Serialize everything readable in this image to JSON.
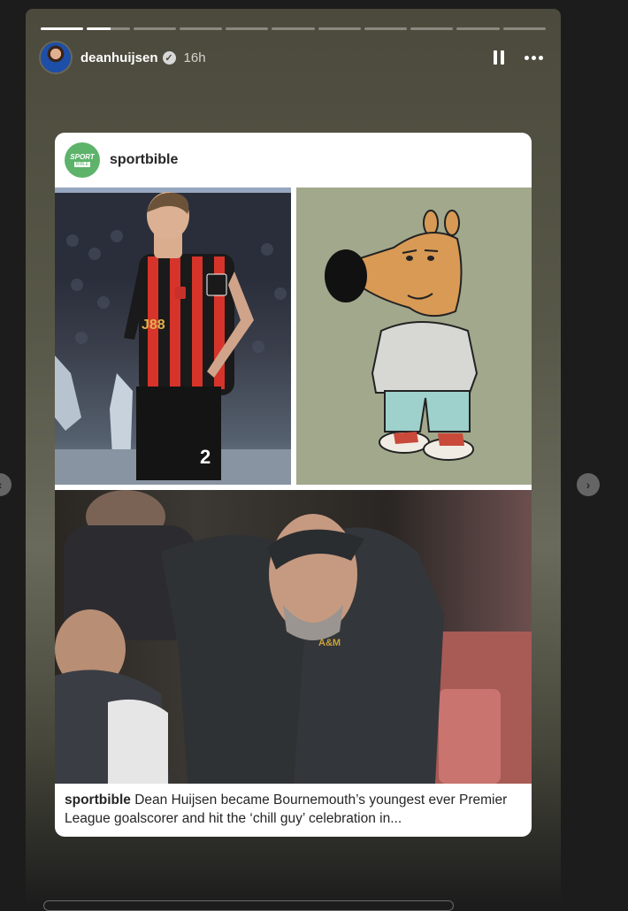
{
  "story": {
    "username": "deanhuijsen",
    "verified_glyph": "✓",
    "timestamp": "16h",
    "progress_segments": 11,
    "active_segment": 2,
    "active_segment_progress": 0.55
  },
  "post": {
    "account": "sportbible",
    "logo_text": "SPORT",
    "logo_subtext": "BIBLE",
    "caption_user": "sportbible",
    "caption_text": " Dean Huijsen became Bournemouth’s youngest ever Premier League goalscorer and hit the ‘chill guy’ celebration in...",
    "shirt_number": "2"
  },
  "icons": {
    "pause": "pause-icon",
    "more": "more-options-icon",
    "prev": "chevron-left-icon",
    "next": "chevron-right-icon"
  },
  "colors": {
    "background": "#1c1c1c",
    "sportbible_green": "#5db36a",
    "cherries_red": "#d6342a"
  }
}
